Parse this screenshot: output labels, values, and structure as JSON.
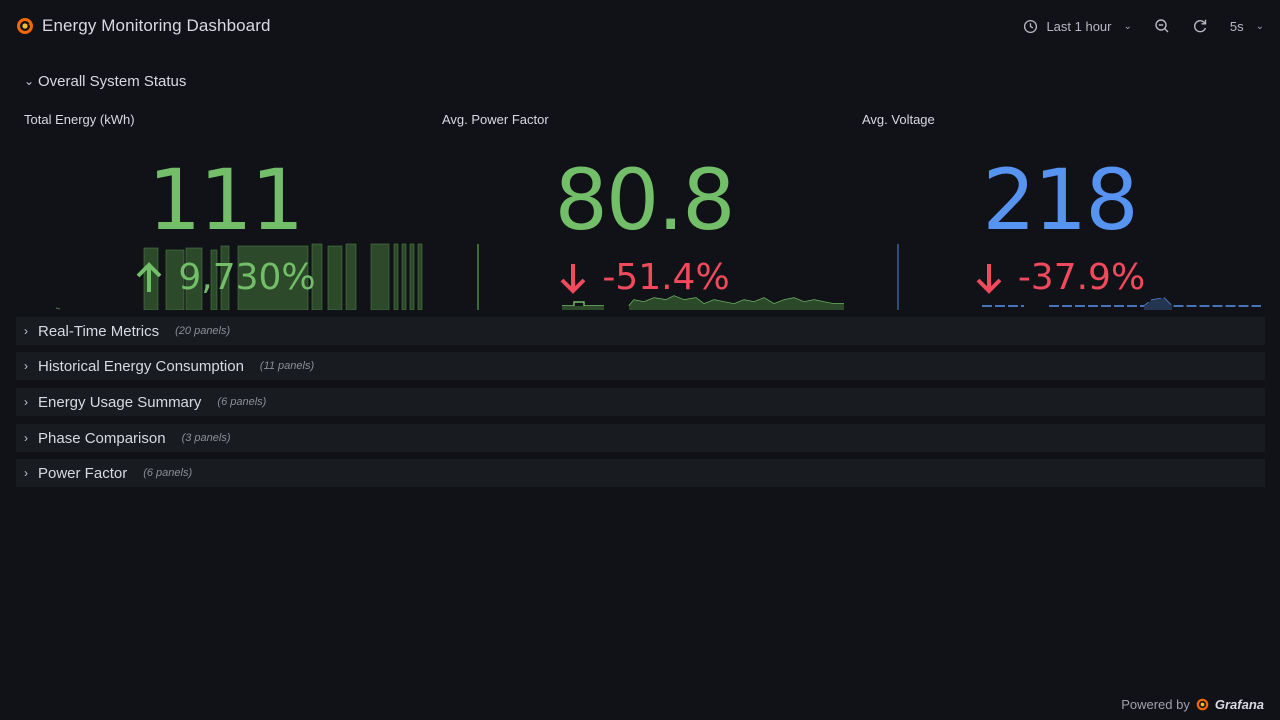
{
  "app": {
    "title": "Energy Monitoring Dashboard"
  },
  "toolbar": {
    "time_range": "Last 1 hour",
    "refresh_interval": "5s"
  },
  "overall": {
    "label": "Overall System Status",
    "expanded": true
  },
  "stats": [
    {
      "title": "Total Energy (kWh)",
      "value": "111",
      "delta": "9,730%",
      "direction": "up",
      "color": "#73bf69",
      "delta_color": "#73bf69"
    },
    {
      "title": "Avg. Power Factor",
      "value": "80.8",
      "delta": "-51.4%",
      "direction": "down",
      "color": "#73bf69",
      "delta_color": "#f2495c"
    },
    {
      "title": "Avg. Voltage",
      "value": "218",
      "delta": "-37.9%",
      "direction": "down",
      "color": "#5794f2",
      "delta_color": "#f2495c"
    }
  ],
  "rows": [
    {
      "label": "Real-Time Metrics",
      "count": "(20 panels)"
    },
    {
      "label": "Historical Energy Consumption",
      "count": "(11 panels)"
    },
    {
      "label": "Energy Usage Summary",
      "count": "(6 panels)"
    },
    {
      "label": "Phase Comparison",
      "count": "(3 panels)"
    },
    {
      "label": "Power Factor",
      "count": "(6 panels)"
    }
  ],
  "footer": {
    "prefix": "Powered by",
    "brand": "Grafana"
  },
  "colors": {
    "background": "#111217",
    "row_bg": "#181b1f",
    "green": "#73bf69",
    "blue": "#5794f2",
    "red": "#f2495c"
  }
}
